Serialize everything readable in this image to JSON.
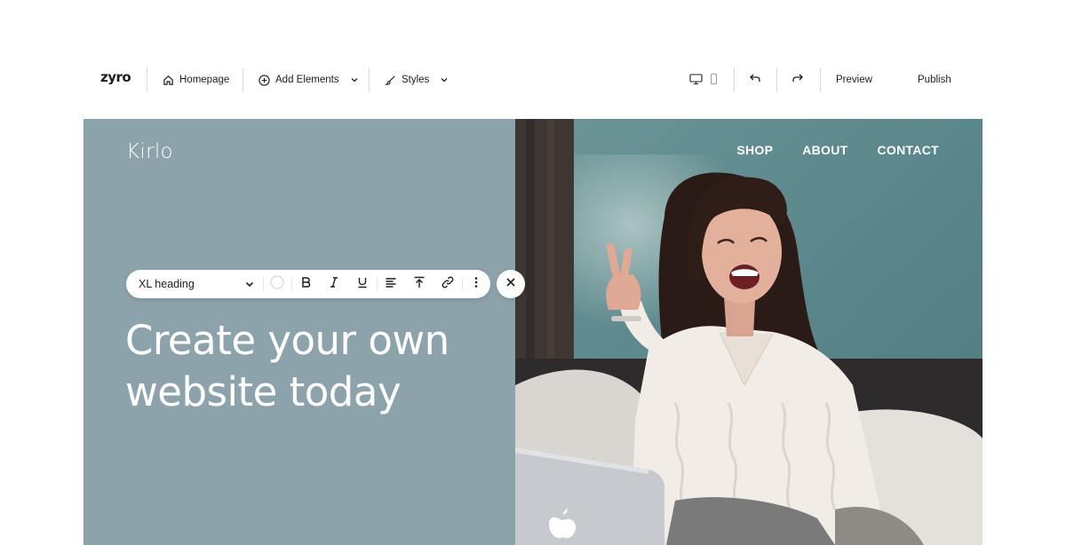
{
  "editor": {
    "logo": "zyro",
    "page_selector": {
      "label": "Homepage",
      "icon": "home-icon"
    },
    "add_elements": {
      "label": "Add Elements",
      "icon": "plus-circle-icon"
    },
    "styles": {
      "label": "Styles",
      "icon": "brush-icon"
    },
    "device_toggle": {
      "desktop_icon": "desktop-icon",
      "mobile_icon": "mobile-icon"
    },
    "undo_icon": "undo-icon",
    "redo_icon": "redo-icon",
    "preview_label": "Preview",
    "publish_label": "Publish"
  },
  "site": {
    "logo": "Kirlo",
    "nav": [
      "SHOP",
      "ABOUT",
      "CONTACT"
    ],
    "hero_title": "Create your own website today",
    "panel_color": "#8da3ab",
    "photo_bg_color": "#5e8a8e"
  },
  "text_toolbar": {
    "style_value": "XL heading",
    "color_swatch": "#ffffff",
    "buttons": [
      "bold-icon",
      "italic-icon",
      "underline-icon",
      "align-left-icon",
      "vertical-align-top-icon",
      "link-icon",
      "more-icon"
    ]
  },
  "close_icon": "close-icon"
}
